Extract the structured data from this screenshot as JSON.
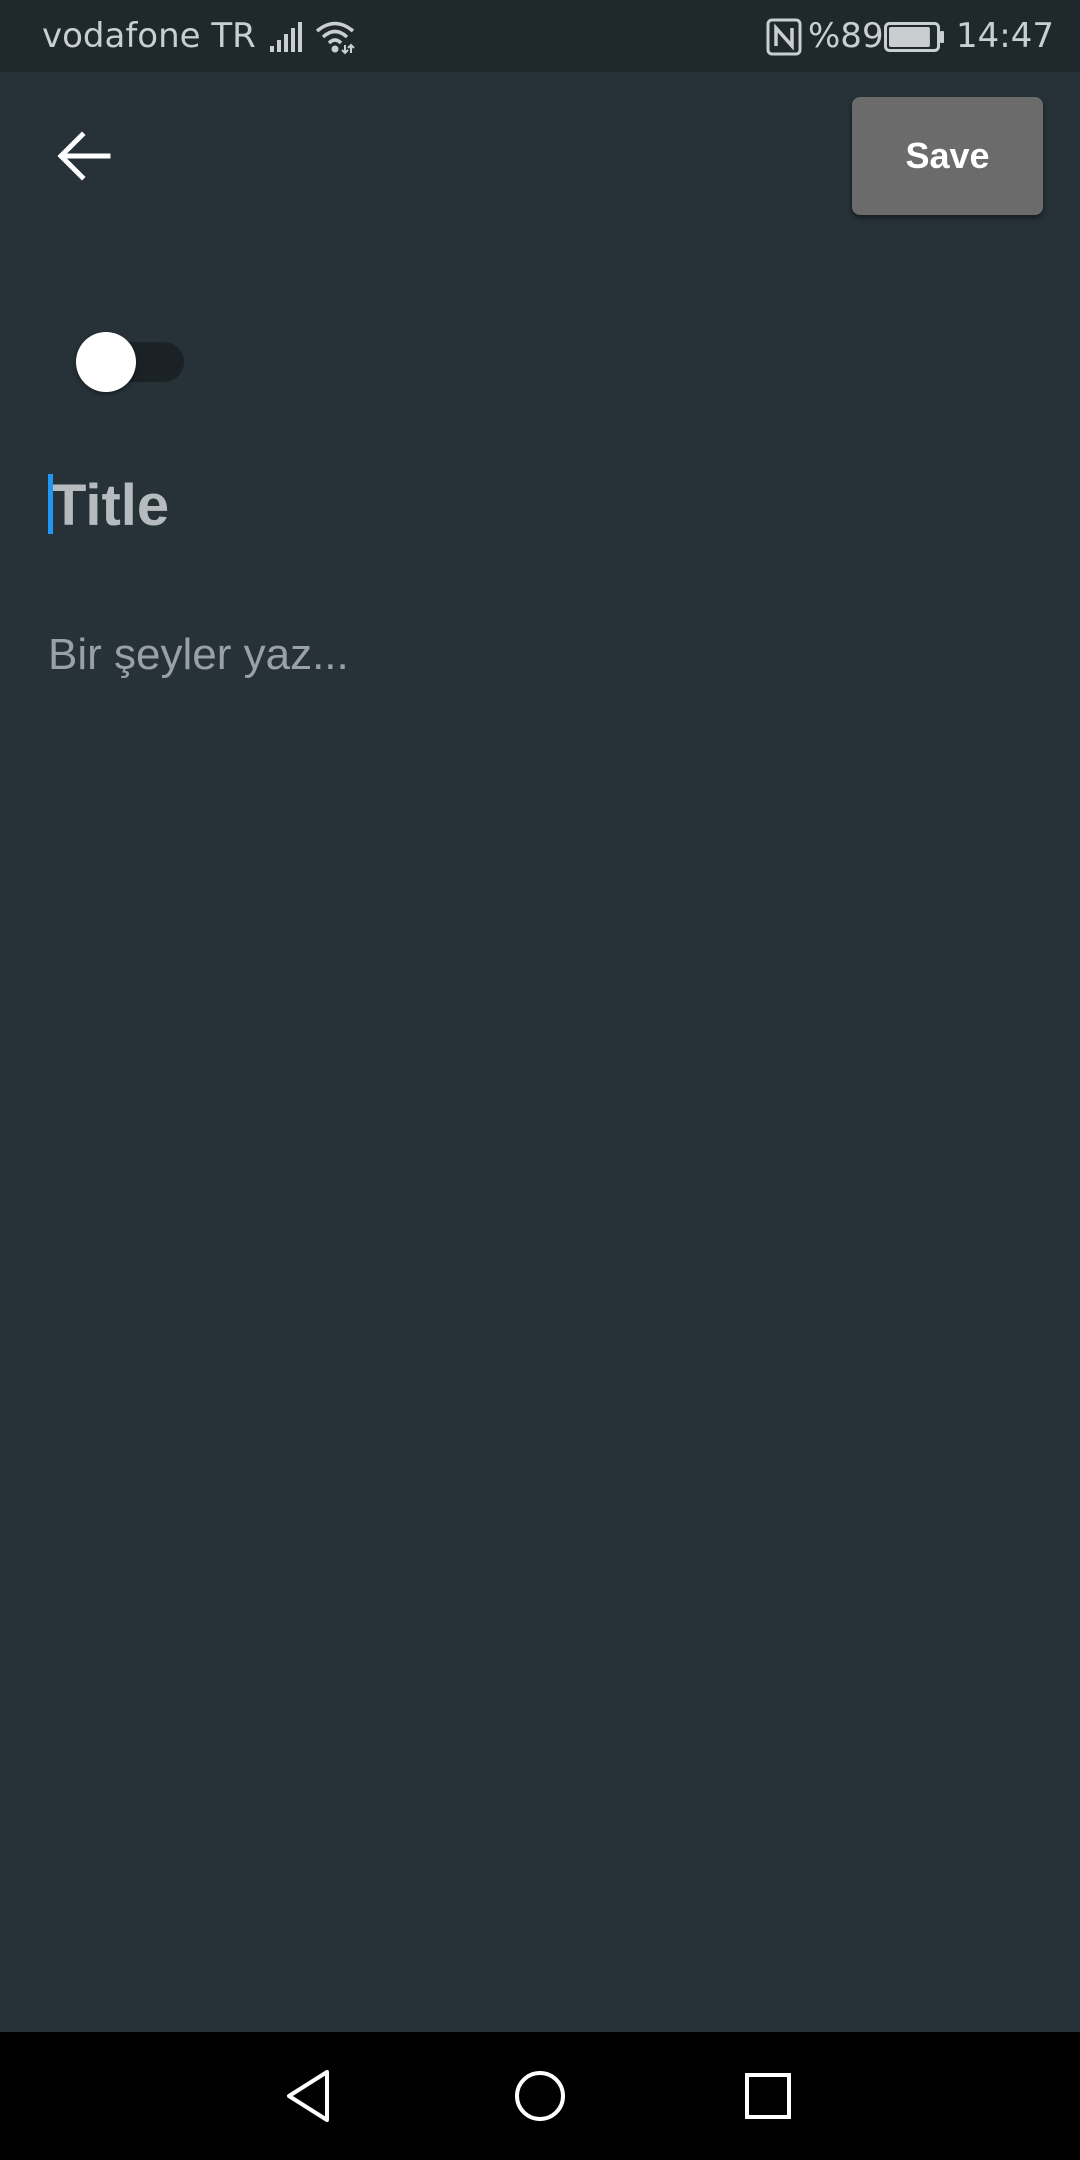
{
  "status_bar": {
    "carrier": "vodafone TR",
    "battery_percent": "%89",
    "time": "14:47",
    "icons": [
      "signal-icon",
      "wifi-icon",
      "nfc-icon",
      "battery-icon"
    ],
    "battery_level": 0.89
  },
  "app_bar": {
    "back_icon": "arrow-left-icon",
    "save_label": "Save"
  },
  "toggle": {
    "checked": false
  },
  "editor": {
    "title_placeholder": "Title",
    "title_value": "",
    "body_placeholder": "Bir şeyler yaz...",
    "body_value": ""
  },
  "nav_bar": {
    "icons": [
      "nav-back-icon",
      "nav-home-icon",
      "nav-recents-icon"
    ]
  },
  "colors": {
    "background": "#263238",
    "status_bar": "#1f282d",
    "save_button": "#6b6b6b",
    "caret": "#2196f3",
    "nav_bar": "#000000"
  }
}
